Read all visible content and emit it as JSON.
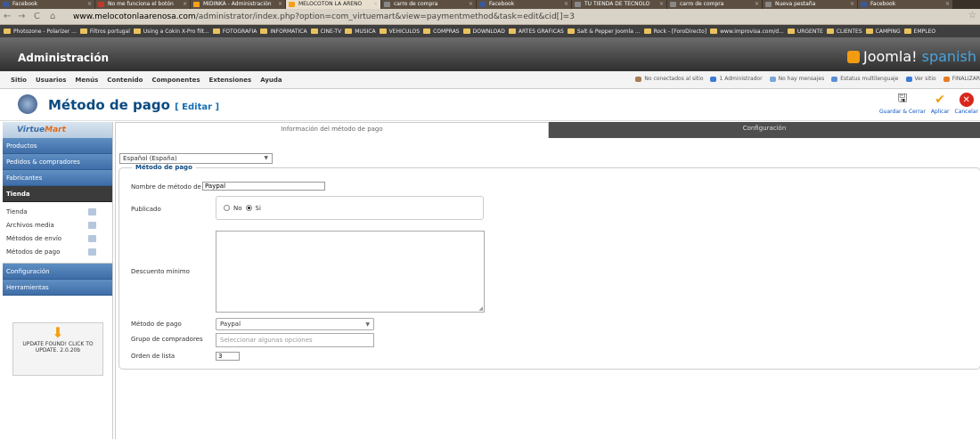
{
  "browser": {
    "tabs": [
      {
        "label": "Facebook",
        "fav": "facebook-icon"
      },
      {
        "label": "No me funciona el botón",
        "fav": "mail-icon"
      },
      {
        "label": "MIDINKA - Administración",
        "fav": "joomla-icon"
      },
      {
        "label": "MELOCOTON LA ARENO",
        "fav": "joomla-icon"
      },
      {
        "label": "carro de compra",
        "fav": "page-icon"
      },
      {
        "label": "Facebook",
        "fav": "facebook-icon"
      },
      {
        "label": "TU TIENDA DE TECNOLO",
        "fav": "page-icon"
      },
      {
        "label": "carro de compra",
        "fav": "page-icon"
      },
      {
        "label": "Nueva pestaña",
        "fav": "page-icon"
      },
      {
        "label": "Facebook",
        "fav": "facebook-icon"
      }
    ],
    "url_host": "www.melocotonlaarenosa.com",
    "url_path": "/administrator/index.php?option=com_virtuemart&view=paymentmethod&task=edit&cid[]=3",
    "bookmarks": [
      "Photozone - Polarizer ...",
      "Filtros portugal",
      "Using a Cokin X-Pro filt...",
      "FOTOGRAFIA",
      "INFORMATICA",
      "CINE-TV",
      "MUSICA",
      "VEHICULOS",
      "COMPRAS",
      "DOWNLOAD",
      "ARTES GRAFICAS",
      "Salt & Pepper Joomla ...",
      "Rock - [ForoDirecto]",
      "www.improvisa.com/d...",
      "URGENTE",
      "CLIENTES",
      "CAMPING",
      "EMPLEO"
    ]
  },
  "admin": {
    "title": "Administración",
    "logo_main": "Joomla!",
    "logo_sub": " spanish",
    "menu": [
      "Sitio",
      "Usuarios",
      "Menús",
      "Contenido",
      "Componentes",
      "Extensiones",
      "Ayuda"
    ],
    "status": [
      "No conectados al sitio",
      "1 Administrador",
      "No hay mensajes",
      "Estatus multilenguaje",
      "Ver sitio",
      "FINALIZAR"
    ]
  },
  "page": {
    "title": "Método de pago",
    "edit": "[ Editar ]",
    "toolbar": {
      "save_close": "Guardar & Cerrar",
      "apply": "Aplicar",
      "cancel": "Cancelar"
    }
  },
  "sidebar": {
    "brand_a": "Virtue",
    "brand_b": "Mart",
    "sections": [
      "Productos",
      "Pedidos & compradores",
      "Fabricantes",
      "Tienda"
    ],
    "tienda_items": [
      "Tienda",
      "Archivos media",
      "Métodos de envío",
      "Métodos de pago"
    ],
    "bottom_sections": [
      "Configuración",
      "Herramientas"
    ],
    "update_text": "UPDATE FOUND! CLICK TO UPDATE. 2.0.20b"
  },
  "content": {
    "tab_info": "Información del método de pago",
    "tab_config": "Configuración",
    "language": "Español (España)",
    "legend": "Método de pago",
    "fields": {
      "name_label": "Nombre de método de pago",
      "name_value": "Paypal",
      "published_label": "Publicado",
      "no_label": "No",
      "yes_label": "Si",
      "discount_label": "Descuento mínimo",
      "method_label": "Método de pago",
      "method_value": "Paypal",
      "groups_label": "Grupo de compradores",
      "groups_placeholder": "Seleccionar algunas opciones",
      "order_label": "Orden de lista",
      "order_value": "3"
    }
  }
}
